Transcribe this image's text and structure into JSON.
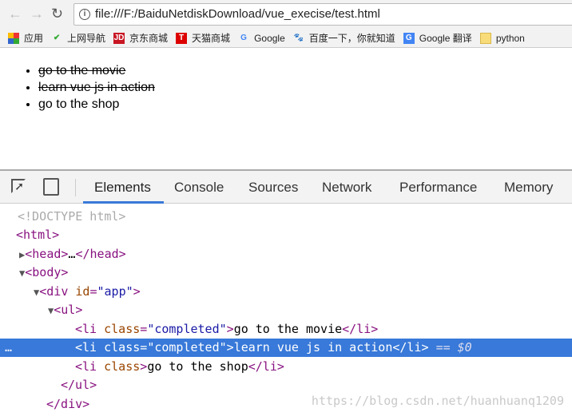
{
  "browser": {
    "url": "file:///F:/BaiduNetdiskDownload/vue_execise/test.html",
    "bookmarks": [
      {
        "label": "应用",
        "icon": "apps-grid-icon"
      },
      {
        "label": "上网导航",
        "icon": "hao-icon"
      },
      {
        "label": "京东商城",
        "icon": "jd-icon"
      },
      {
        "label": "天猫商城",
        "icon": "tmall-icon"
      },
      {
        "label": "Google",
        "icon": "google-icon"
      },
      {
        "label": "百度一下，你就知道",
        "icon": "baidu-icon"
      },
      {
        "label": "Google 翻译",
        "icon": "translate-icon"
      },
      {
        "label": "python",
        "icon": "folder-icon"
      }
    ]
  },
  "page": {
    "items": [
      {
        "text": "go to the movie",
        "completed": true
      },
      {
        "text": "learn vue js in action",
        "completed": true
      },
      {
        "text": "go to the shop",
        "completed": false
      }
    ]
  },
  "devtools": {
    "tabs": [
      "Elements",
      "Console",
      "Sources",
      "Network",
      "Performance",
      "Memory"
    ],
    "active_tab": "Elements",
    "selected_suffix": "== $0",
    "ellipsis": "…",
    "watermark": "https://blog.csdn.net/huanhuanq1209"
  },
  "colors": {
    "accent": "#3879d9"
  }
}
